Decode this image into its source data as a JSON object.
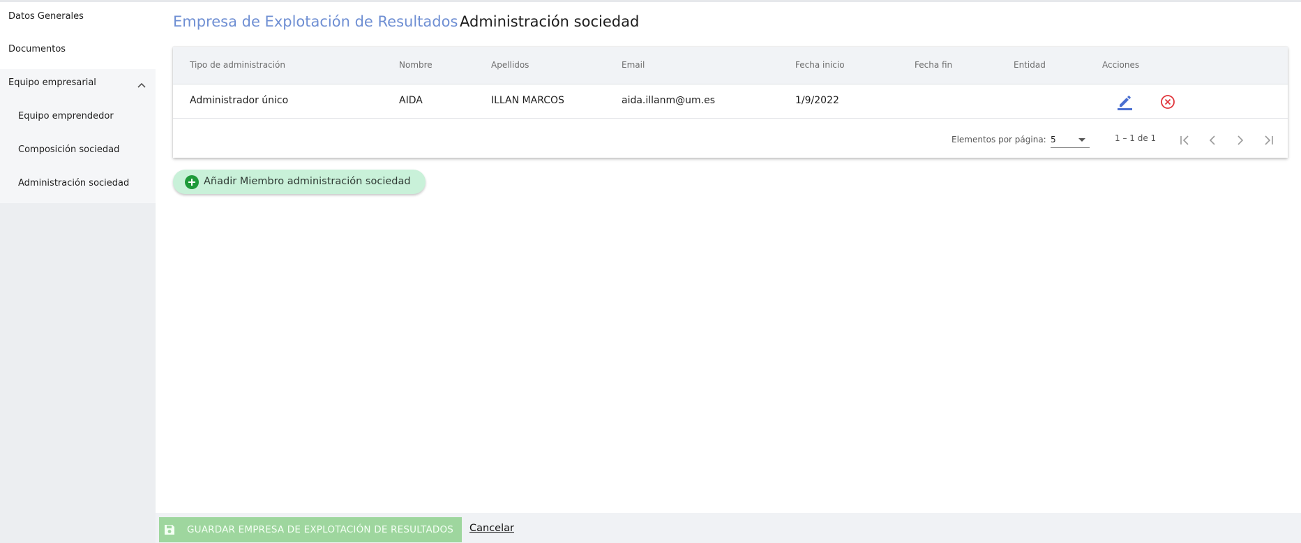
{
  "sidebar": {
    "items": [
      {
        "label": "Datos Generales"
      },
      {
        "label": "Documentos"
      },
      {
        "label": "Equipo empresarial"
      },
      {
        "label": "Equipo emprendedor"
      },
      {
        "label": "Composición sociedad"
      },
      {
        "label": "Administración sociedad"
      }
    ]
  },
  "header": {
    "title_main": "Empresa de Explotación de Resultados",
    "title_section": "Administración sociedad"
  },
  "table": {
    "columns": [
      "Tipo de administración",
      "Nombre",
      "Apellidos",
      "Email",
      "Fecha inicio",
      "Fecha fin",
      "Entidad",
      "Acciones"
    ],
    "rows": [
      {
        "tipo": "Administrador único",
        "nombre": "AIDA",
        "apellidos": "ILLAN MARCOS",
        "email": "aida.illanm@um.es",
        "fecha_inicio": "1/9/2022",
        "fecha_fin": "",
        "entidad": ""
      }
    ]
  },
  "paginator": {
    "items_per_page_label": "Elementos por página:",
    "items_per_page_value": "5",
    "range_label": "1 – 1 de 1"
  },
  "add_button": {
    "label": "Añadir Miembro administración sociedad"
  },
  "footer": {
    "save_label": "GUARDAR EMPRESA DE EXPLOTACIÓN DE RESULTADOS",
    "cancel_label": "Cancelar"
  },
  "colors": {
    "title_accent": "#6f8fd3",
    "edit_icon": "#4a6fd0",
    "delete_icon": "#e0353b",
    "add_button_bg": "#c9f1d9",
    "add_icon": "#1e9a3a",
    "save_button_bg": "#9ed69e"
  },
  "icons": [
    "chevron-up-icon",
    "edit-icon",
    "delete-icon",
    "first-page-icon",
    "prev-page-icon",
    "next-page-icon",
    "last-page-icon",
    "add-icon",
    "save-icon"
  ]
}
